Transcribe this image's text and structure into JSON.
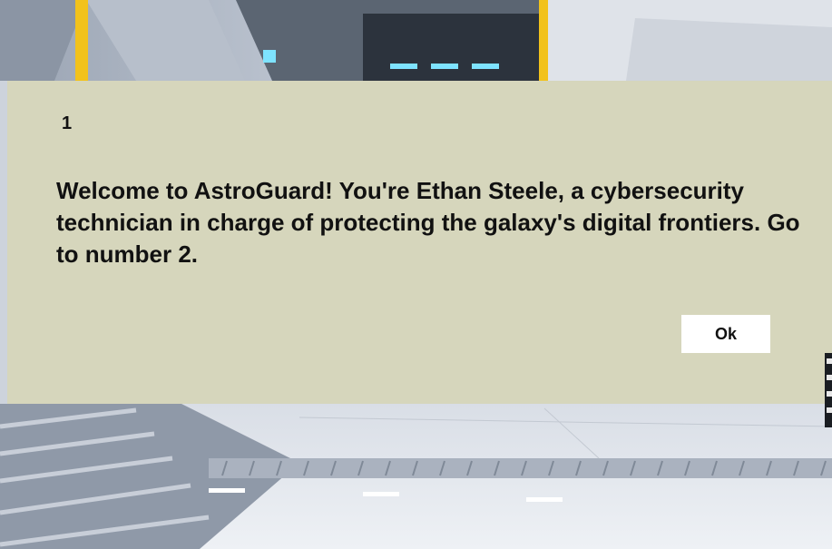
{
  "dialog": {
    "step_number": "1",
    "message": "Welcome to AstroGuard! You're Ethan Steele, a cybersecurity technician in charge of protecting the galaxy's digital frontiers. Go to number 2.",
    "ok_label": "Ok"
  },
  "colors": {
    "dialog_background": "#d6d6bc",
    "button_background": "#ffffff",
    "text": "#111111",
    "ceiling_light": "#7ee3ff",
    "yellow_trim": "#f2c21b"
  }
}
